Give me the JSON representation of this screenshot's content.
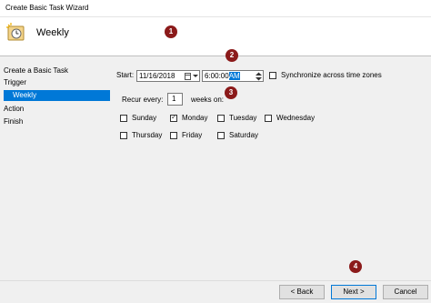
{
  "window": {
    "title": "Create Basic Task Wizard"
  },
  "header": {
    "title": "Weekly"
  },
  "nav": {
    "items": [
      "Create a Basic Task",
      "Trigger",
      "Weekly",
      "Action",
      "Finish"
    ]
  },
  "form": {
    "start_label": "Start:",
    "date_value": "11/16/2018",
    "time_value_prefix": "6:00:00",
    "time_value_ampm": "AM",
    "sync_label": "Synchronize across time zones",
    "recur_label": "Recur every:",
    "recur_value": "1",
    "weeks_label": "weeks on:",
    "days": [
      {
        "name": "Sunday",
        "checked": false
      },
      {
        "name": "Monday",
        "checked": true
      },
      {
        "name": "Tuesday",
        "checked": false
      },
      {
        "name": "Wednesday",
        "checked": false
      },
      {
        "name": "Thursday",
        "checked": false
      },
      {
        "name": "Friday",
        "checked": false
      },
      {
        "name": "Saturday",
        "checked": false
      }
    ]
  },
  "footer": {
    "back_label": "< Back",
    "next_label": "Next >",
    "cancel_label": "Cancel"
  },
  "markers": [
    "1",
    "2",
    "3",
    "4"
  ],
  "colors": {
    "accent": "#0078d7",
    "marker": "#8b1a1a"
  }
}
